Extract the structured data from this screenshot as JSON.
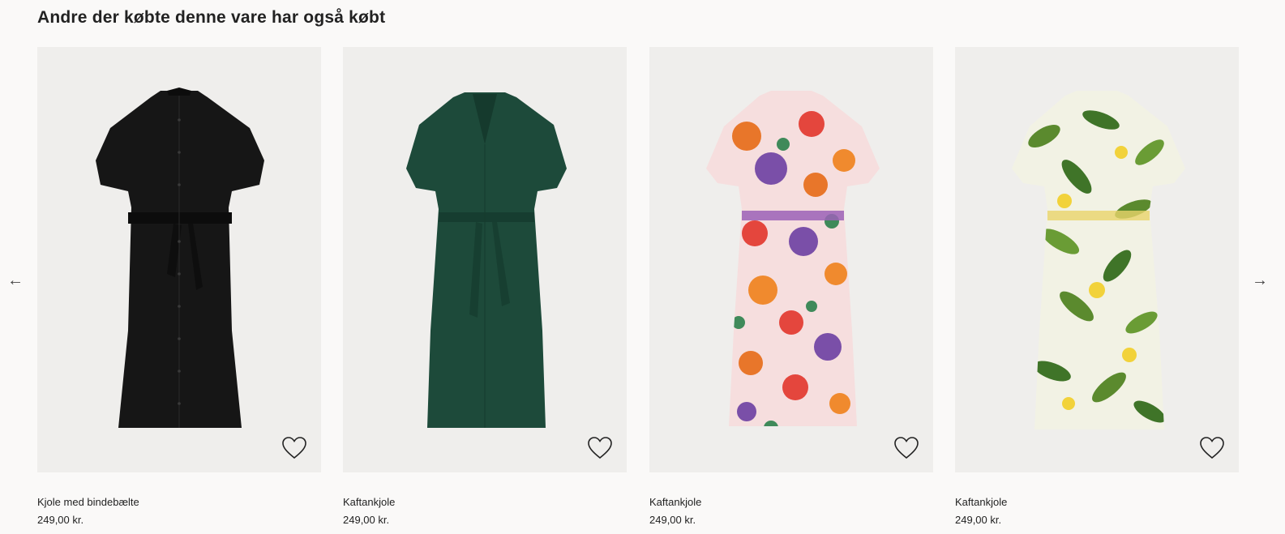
{
  "section": {
    "title": "Andre der købte denne vare har også købt"
  },
  "carousel": {
    "prev_icon": "arrow-left-icon",
    "next_icon": "arrow-right-icon",
    "prev_glyph": "←",
    "next_glyph": "→"
  },
  "products": [
    {
      "name": "Kjole med bindebælte",
      "price": "249,00 kr.",
      "favorite_icon": "heart-outline-icon",
      "dress_color": "#161616",
      "pattern": "solid"
    },
    {
      "name": "Kaftankjole",
      "price": "249,00 kr.",
      "favorite_icon": "heart-outline-icon",
      "dress_color": "#1d4a3a",
      "pattern": "solid"
    },
    {
      "name": "Kaftankjole",
      "price": "249,00 kr.",
      "favorite_icon": "heart-outline-icon",
      "dress_color": "#f6dede",
      "pattern": "floral"
    },
    {
      "name": "Kaftankjole",
      "price": "249,00 kr.",
      "favorite_icon": "heart-outline-icon",
      "dress_color": "#f2f2e4",
      "pattern": "lemon"
    }
  ]
}
